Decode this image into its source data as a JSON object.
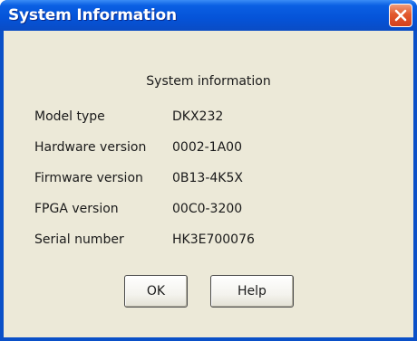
{
  "window": {
    "title": "System Information",
    "close_icon": "close-icon"
  },
  "dialog": {
    "heading": "System information",
    "rows": [
      {
        "label": "Model type",
        "value": "DKX232"
      },
      {
        "label": "Hardware version",
        "value": "0002-1A00"
      },
      {
        "label": "Firmware version",
        "value": "0B13-4K5X"
      },
      {
        "label": "FPGA version",
        "value": "00C0-3200"
      },
      {
        "label": "Serial number",
        "value": "HK3E700076"
      }
    ],
    "buttons": {
      "ok": "OK",
      "help": "Help"
    }
  },
  "colors": {
    "titlebar": "#0553d8",
    "frame": "#0a50c8",
    "client_background": "#ece9d8",
    "close_button": "#e2592e"
  }
}
